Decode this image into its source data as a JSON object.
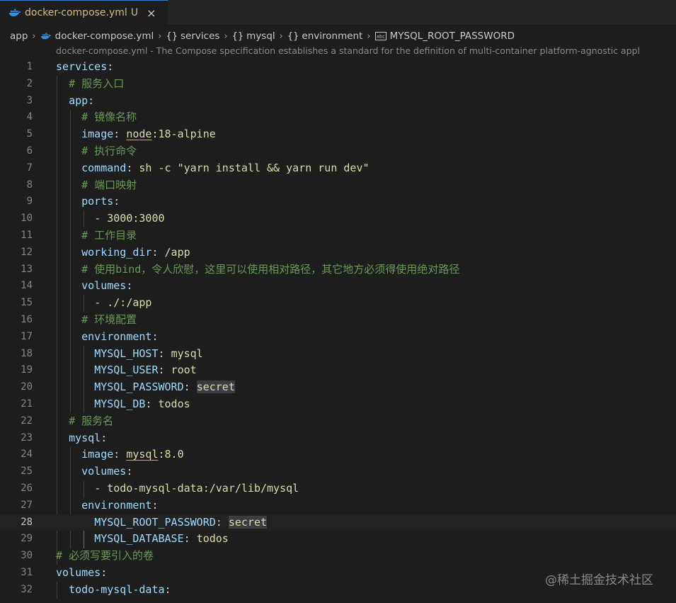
{
  "tab": {
    "filename": "docker-compose.yml",
    "badge": "U",
    "close": "×",
    "icon": "docker-whale-icon"
  },
  "breadcrumbs": {
    "items": [
      "app",
      "docker-compose.yml",
      "services",
      "mysql",
      "environment",
      "MYSQL_ROOT_PASSWORD"
    ],
    "obj_symbol": "{}"
  },
  "codelens": "docker-compose.yml - The Compose specification establishes a standard for the definition of multi-container platform-agnostic appl",
  "lines": {
    "l1": {
      "num": "1",
      "key": "services"
    },
    "l2": {
      "num": "2",
      "comment": "# 服务入口"
    },
    "l3": {
      "num": "3",
      "key": "app"
    },
    "l4": {
      "num": "4",
      "comment": "# 镜像名称"
    },
    "l5": {
      "num": "5",
      "key": "image",
      "val_a": "node",
      "val_b": ":18-alpine"
    },
    "l6": {
      "num": "6",
      "comment": "# 执行命令"
    },
    "l7": {
      "num": "7",
      "key": "command",
      "val": "sh -c \"yarn install && yarn run dev\""
    },
    "l8": {
      "num": "8",
      "comment": "# 端口映射"
    },
    "l9": {
      "num": "9",
      "key": "ports"
    },
    "l10": {
      "num": "10",
      "dash": "- ",
      "val": "3000:3000"
    },
    "l11": {
      "num": "11",
      "comment": "# 工作目录"
    },
    "l12": {
      "num": "12",
      "key": "working_dir",
      "val": "/app"
    },
    "l13": {
      "num": "13",
      "comment": "# 使用bind，令人欣慰，这里可以使用相对路径，其它地方必须得使用绝对路径"
    },
    "l14": {
      "num": "14",
      "key": "volumes"
    },
    "l15": {
      "num": "15",
      "dash": "- ",
      "val": "./:/app"
    },
    "l16": {
      "num": "16",
      "comment": "# 环境配置"
    },
    "l17": {
      "num": "17",
      "key": "environment"
    },
    "l18": {
      "num": "18",
      "key": "MYSQL_HOST",
      "val": "mysql"
    },
    "l19": {
      "num": "19",
      "key": "MYSQL_USER",
      "val": "root"
    },
    "l20": {
      "num": "20",
      "key": "MYSQL_PASSWORD",
      "val": "secret"
    },
    "l21": {
      "num": "21",
      "key": "MYSQL_DB",
      "val": "todos"
    },
    "l22": {
      "num": "22",
      "comment": "# 服务名"
    },
    "l23": {
      "num": "23",
      "key": "mysql"
    },
    "l24": {
      "num": "24",
      "key": "image",
      "val_a": "mysql",
      "val_b": ":8.0"
    },
    "l25": {
      "num": "25",
      "key": "volumes"
    },
    "l26": {
      "num": "26",
      "dash": "- ",
      "val": "todo-mysql-data:/var/lib/mysql"
    },
    "l27": {
      "num": "27",
      "key": "environment"
    },
    "l28": {
      "num": "28",
      "key": "MYSQL_ROOT_PASSWORD",
      "val": "secret"
    },
    "l29": {
      "num": "29",
      "key": "MYSQL_DATABASE",
      "val": "todos"
    },
    "l30": {
      "num": "30",
      "comment": "# 必须写要引入的卷"
    },
    "l31": {
      "num": "31",
      "key": "volumes"
    },
    "l32": {
      "num": "32",
      "key": "todo-mysql-data"
    }
  },
  "colon": ":",
  "watermark": "@稀土掘金技术社区",
  "colors": {
    "key": "#9cdcfe",
    "string": "#ce9178",
    "comment": "#6a9955",
    "number": "#b5cea8",
    "tab_accent": "#2f82d4"
  }
}
